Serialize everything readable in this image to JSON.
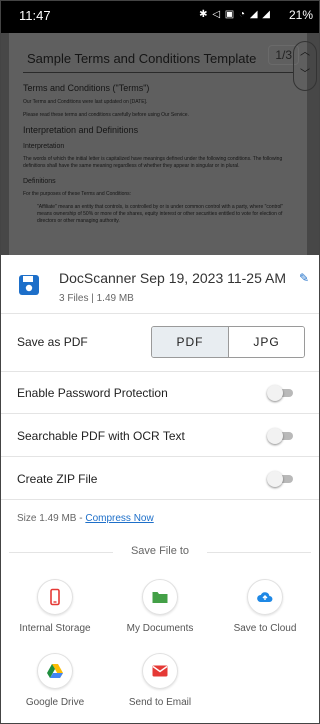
{
  "status_bar": {
    "time": "11:47",
    "icons_text": "✱ ◁ ▣ ◔ ◢ ◢",
    "battery": "21%"
  },
  "preview": {
    "page_counter": "1/3",
    "doc_title": "Sample Terms and Conditions Template",
    "doc_subtitle": "Terms and Conditions (\"Terms\")",
    "line1": "Our Terms and Conditions were last updated on [DATE].",
    "line2": "Please read these terms and conditions carefully before using Our Service.",
    "section1": "Interpretation and Definitions",
    "section1a": "Interpretation",
    "para1": "The words of which the initial letter is capitalized have meanings defined under the following conditions. The following definitions shall have the same meaning regardless of whether they appear in singular or in plural.",
    "section2": "Definitions",
    "para2": "For the purposes of these Terms and Conditions:",
    "bullet1": "\"Affiliate\" means an entity that controls, is controlled by or is under common control with a party, where \"control\" means ownership of 50% or more of the shares, equity interest or other securities entitled to vote for election of directors or other managing authority."
  },
  "sheet": {
    "file_name": "DocScanner Sep 19, 2023 11-25 AM",
    "file_info": "3 Files  |  1.49 MB",
    "save_as_label": "Save as PDF",
    "format_pdf": "PDF",
    "format_jpg": "JPG",
    "selected_format": "PDF",
    "options": [
      {
        "label": "Enable Password Protection",
        "enabled": false
      },
      {
        "label": "Searchable PDF with OCR Text",
        "enabled": false
      },
      {
        "label": "Create ZIP File",
        "enabled": false
      }
    ],
    "size_text": "Size 1.49 MB - ",
    "compress_link": "Compress Now",
    "save_file_to": "Save File to",
    "destinations": [
      {
        "label": "Internal Storage",
        "icon": "phone-icon",
        "color": "#e53935"
      },
      {
        "label": "My Documents",
        "icon": "folder-icon",
        "color": "#43a047"
      },
      {
        "label": "Save to Cloud",
        "icon": "cloud-upload-icon",
        "color": "#1e88e5"
      },
      {
        "label": "Google Drive",
        "icon": "google-drive-icon",
        "color": "#fbbc04"
      },
      {
        "label": "Send to Email",
        "icon": "email-icon",
        "color": "#e53935"
      }
    ]
  },
  "colors": {
    "accent": "#1d6fc9"
  }
}
